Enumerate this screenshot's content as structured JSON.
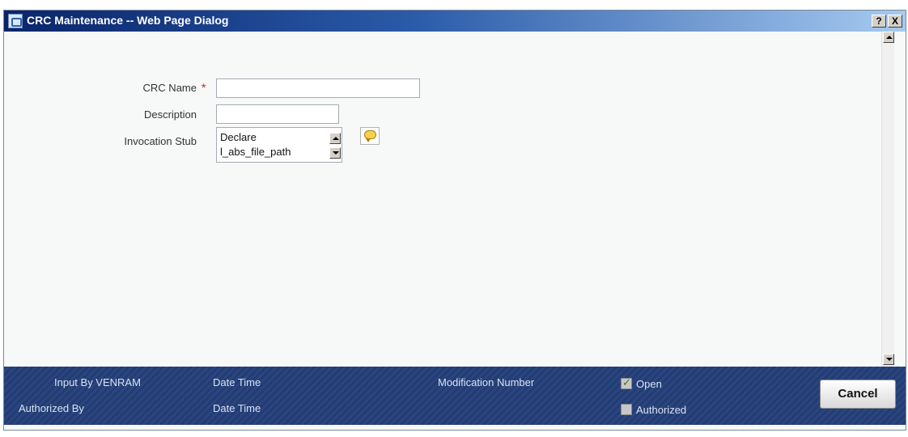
{
  "window": {
    "title": "CRC Maintenance -- Web Page Dialog",
    "help_label": "?",
    "close_label": "X"
  },
  "form": {
    "crc_name": {
      "label": "CRC Name",
      "required_mark": "*",
      "value": ""
    },
    "description": {
      "label": "Description",
      "value": ""
    },
    "invocation_stub": {
      "label": "Invocation Stub",
      "lines": [
        "Declare",
        "l_abs_file_path"
      ]
    }
  },
  "footer": {
    "input_by": "Input By VENRAM",
    "authorized_by": "Authorized By",
    "date_time_1": "Date Time",
    "date_time_2": "Date Time",
    "modification_number": "Modification Number",
    "open": {
      "label": "Open",
      "checked": true
    },
    "authorized": {
      "label": "Authorized",
      "checked": false
    },
    "cancel_label": "Cancel"
  },
  "colors": {
    "title_gradient_start": "#0a246a",
    "footer_bg": "#243c72",
    "required": "#c81e1e"
  },
  "icons": [
    "app-icon",
    "help-icon",
    "close-icon",
    "comment-icon",
    "scroll-up-icon",
    "scroll-down-icon"
  ]
}
